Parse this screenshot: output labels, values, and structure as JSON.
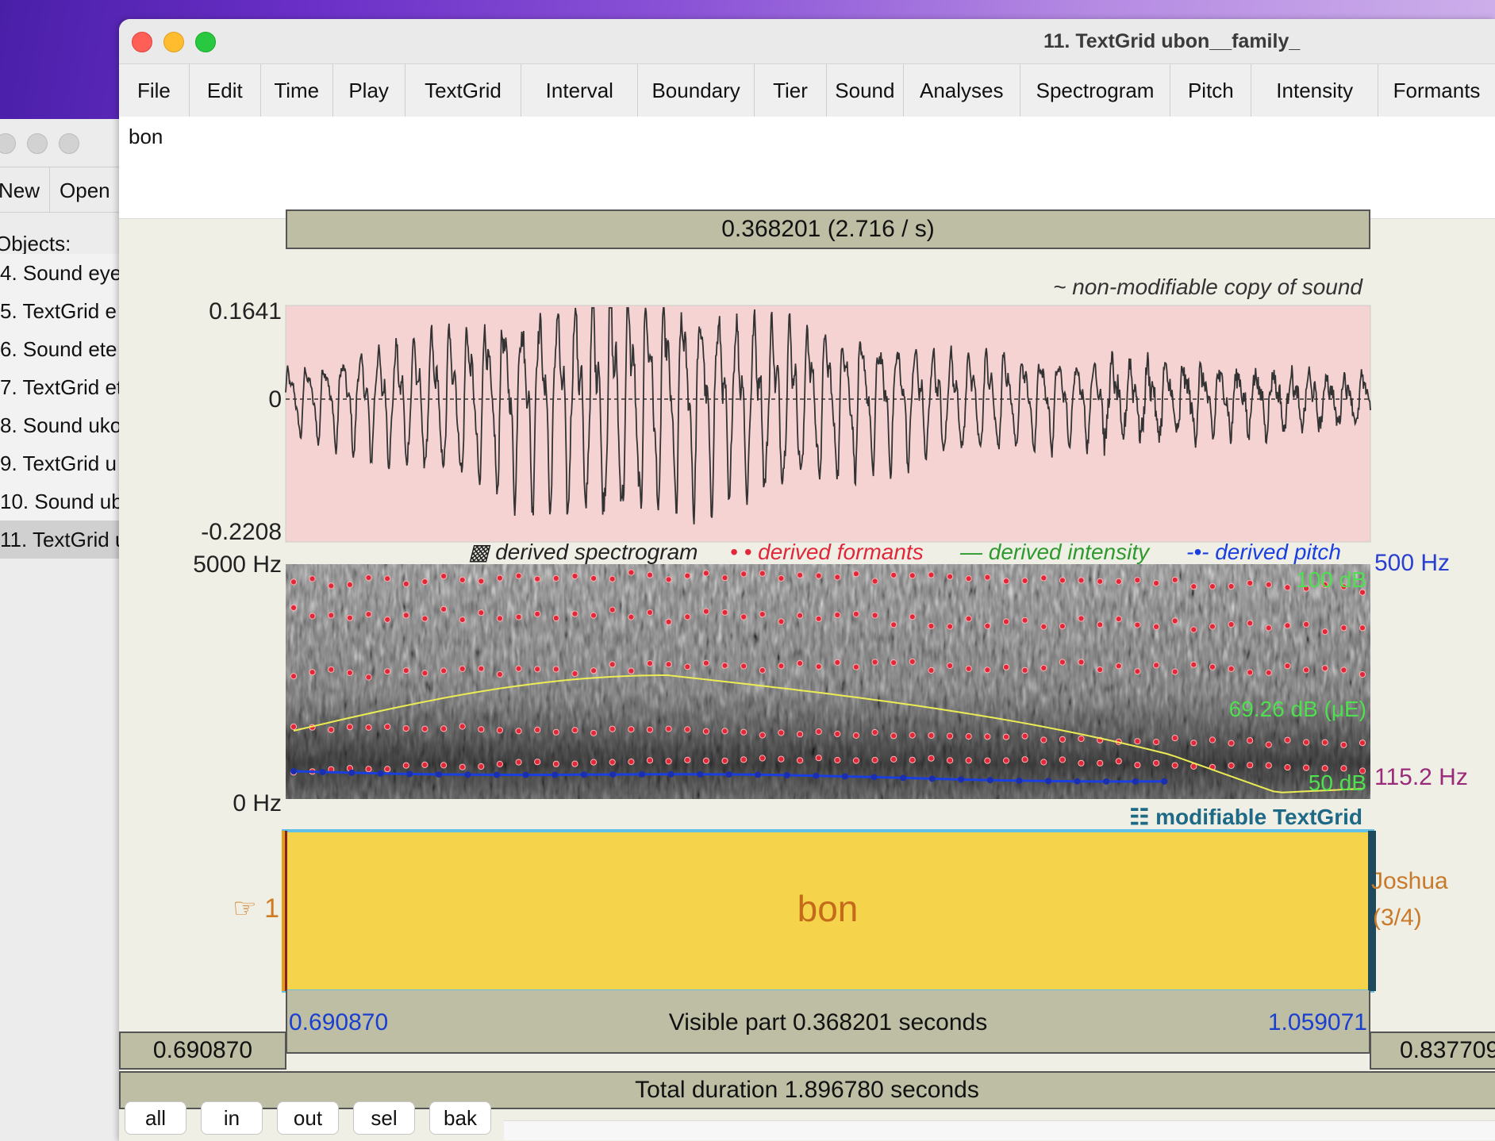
{
  "objects_window": {
    "toolbar": [
      "New",
      "Open"
    ],
    "objects_label": "Objects:",
    "items": [
      {
        "label": "4. Sound eye",
        "selected": false
      },
      {
        "label": "5. TextGrid e",
        "selected": false
      },
      {
        "label": "6. Sound ete",
        "selected": false
      },
      {
        "label": "7. TextGrid et",
        "selected": false
      },
      {
        "label": "8. Sound uko",
        "selected": false
      },
      {
        "label": "9. TextGrid u",
        "selected": false
      },
      {
        "label": "10. Sound ub",
        "selected": false
      },
      {
        "label": "11. TextGrid u",
        "selected": true
      }
    ]
  },
  "editor": {
    "title": "11. TextGrid ubon__family_",
    "menus": [
      "File",
      "Edit",
      "Time",
      "Play",
      "TextGrid",
      "Interval",
      "Boundary",
      "Tier",
      "Sound",
      "Analyses",
      "Spectrogram",
      "Pitch",
      "Intensity",
      "Formants"
    ],
    "text_content": "bon",
    "selection_bar": "0.368201 (2.716 / s)",
    "sound_label": "~ non-modifiable copy of sound",
    "amp_max": "0.1641",
    "amp_zero": "0",
    "amp_min": "-0.2208",
    "legend": {
      "spectrogram": "▩ derived spectrogram",
      "formants": "• • derived formants",
      "intensity": "— derived intensity",
      "pitch": "-•- derived pitch"
    },
    "freq_max": "5000 Hz",
    "freq_min": "0 Hz",
    "pitch_max": "500 Hz",
    "pitch_min": "115.2 Hz",
    "intensity_max": "100 dB",
    "intensity_cursor": "69.26 dB (μE)",
    "intensity_min": "50 dB",
    "textgrid_label": "☷ modifiable TextGrid",
    "tier_number": "☞ 1",
    "interval_text": "bon",
    "tier_name": "Joshua",
    "tier_count": "(3/4)",
    "visible_start": "0.690870",
    "visible_part": "Visible part 0.368201 seconds",
    "visible_end": "1.059071",
    "left_time": "0.690870",
    "right_time": "0.837709",
    "total_duration": "Total duration 1.896780 seconds",
    "zoom_buttons": [
      "all",
      "in",
      "out",
      "sel",
      "bak"
    ]
  },
  "colors": {
    "waveform_bg": "#f6d3d3",
    "textgrid_interval": "#f5d44c",
    "formant": "#e0283a",
    "intensity": "#e8e84a",
    "pitch": "#1a3fe0",
    "panel": "#bebea5"
  }
}
